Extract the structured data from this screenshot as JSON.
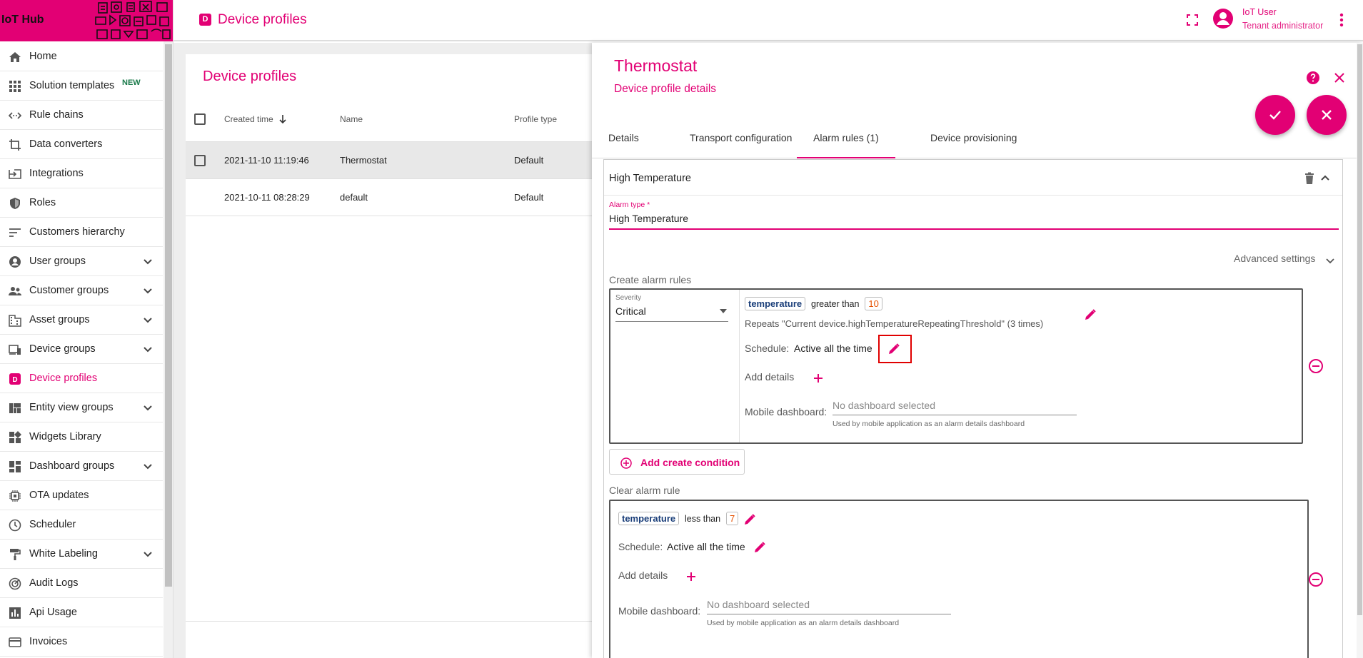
{
  "app": {
    "brand": "IoT Hub"
  },
  "header": {
    "page_title": "Device profiles",
    "page_icon_letter": "D",
    "user_name": "IoT User",
    "user_role": "Tenant administrator"
  },
  "sidebar": {
    "items": [
      {
        "label": "Home",
        "icon": "home-icon"
      },
      {
        "label": "Solution templates",
        "icon": "grid-icon",
        "badge": "NEW"
      },
      {
        "label": "Rule chains",
        "icon": "rule-chain-icon"
      },
      {
        "label": "Data converters",
        "icon": "crop-icon"
      },
      {
        "label": "Integrations",
        "icon": "input-icon"
      },
      {
        "label": "Roles",
        "icon": "shield-icon"
      },
      {
        "label": "Customers hierarchy",
        "icon": "sort-icon"
      },
      {
        "label": "User groups",
        "icon": "account-circle-icon",
        "expandable": true
      },
      {
        "label": "Customer groups",
        "icon": "supervisor-icon",
        "expandable": true
      },
      {
        "label": "Asset groups",
        "icon": "domain-icon",
        "expandable": true
      },
      {
        "label": "Device groups",
        "icon": "devices-icon",
        "expandable": true
      },
      {
        "label": "Device profiles",
        "icon": "device-profile-icon",
        "active": true
      },
      {
        "label": "Entity view groups",
        "icon": "view-quilt-icon",
        "expandable": true
      },
      {
        "label": "Widgets Library",
        "icon": "widgets-icon"
      },
      {
        "label": "Dashboard groups",
        "icon": "dashboard-icon",
        "expandable": true
      },
      {
        "label": "OTA updates",
        "icon": "memory-icon"
      },
      {
        "label": "Scheduler",
        "icon": "clock-icon"
      },
      {
        "label": "White Labeling",
        "icon": "format-paint-icon",
        "expandable": true
      },
      {
        "label": "Audit Logs",
        "icon": "track-changes-icon"
      },
      {
        "label": "Api Usage",
        "icon": "insert-chart-icon"
      },
      {
        "label": "Invoices",
        "icon": "credit-card-icon"
      }
    ]
  },
  "list": {
    "title": "Device profiles",
    "columns": [
      "Created time",
      "Name",
      "Profile type"
    ],
    "rows": [
      {
        "created": "2021-11-10 11:19:46",
        "name": "Thermostat",
        "type": "Default",
        "selected": true
      },
      {
        "created": "2021-10-11 08:28:29",
        "name": "default",
        "type": "Default",
        "selected": false
      }
    ]
  },
  "panel": {
    "title": "Thermostat",
    "subtitle": "Device profile details",
    "tabs": [
      "Details",
      "Transport configuration",
      "Alarm rules (1)",
      "Device provisioning"
    ],
    "active_tab": 2,
    "alarm": {
      "header_title": "High Temperature",
      "type_label": "Alarm type *",
      "type_value": "High Temperature",
      "advanced_settings": "Advanced settings",
      "create_rules_label": "Create alarm rules",
      "severity_label": "Severity",
      "severity_value": "Critical",
      "create_condition": {
        "key": "temperature",
        "operator": "greater than",
        "value": "10",
        "repeats": "Repeats \"Current device.highTemperatureRepeatingThreshold\" (3 times)",
        "schedule_label": "Schedule:",
        "schedule_value": "Active all the time",
        "add_details": "Add details",
        "mobile_label": "Mobile dashboard:",
        "mobile_placeholder": "No dashboard selected",
        "mobile_hint": "Used by mobile application as an alarm details dashboard"
      },
      "add_create_condition": "Add create condition",
      "clear_rule_label": "Clear alarm rule",
      "clear_condition": {
        "key": "temperature",
        "operator": "less than",
        "value": "7",
        "schedule_label": "Schedule:",
        "schedule_value": "Active all the time",
        "add_details": "Add details",
        "mobile_label": "Mobile dashboard:",
        "mobile_placeholder": "No dashboard selected",
        "mobile_hint": "Used by mobile application as an alarm details dashboard"
      }
    }
  },
  "colors": {
    "accent": "#e20074",
    "highlight": "#e00000"
  }
}
